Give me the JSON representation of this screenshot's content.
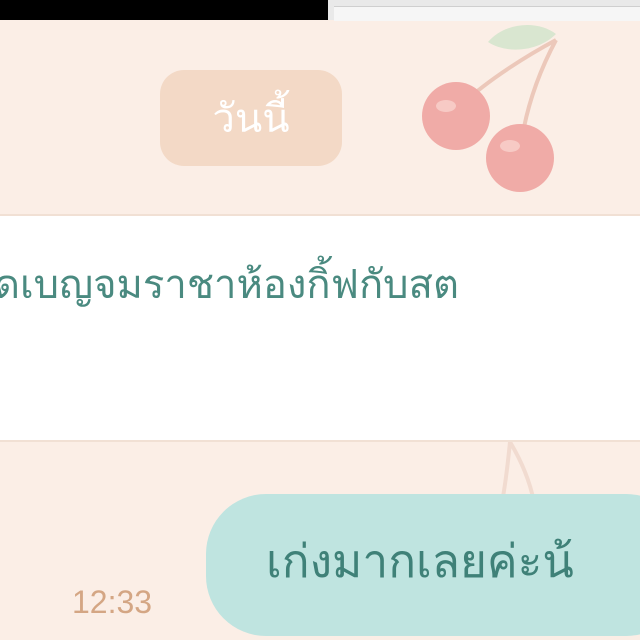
{
  "status_strip": {},
  "date_separator": {
    "label": "วันนี้"
  },
  "messages": [
    {
      "direction": "incoming",
      "text": "ดเบญจมราชาห้องกิ้ฟกับสต"
    },
    {
      "direction": "outgoing",
      "text": "เก่งมากเลยค่ะน้",
      "time": "12:33"
    }
  ],
  "theme": {
    "background": "#fbeee6",
    "date_pill": "#f3d9c6",
    "incoming_band": "#ffffff",
    "outgoing_bubble": "#bfe4e0",
    "text_color": "#4a8a80",
    "time_color": "#d4a684"
  },
  "decoration": {
    "wallpaper_icon": "cherry-icon"
  }
}
